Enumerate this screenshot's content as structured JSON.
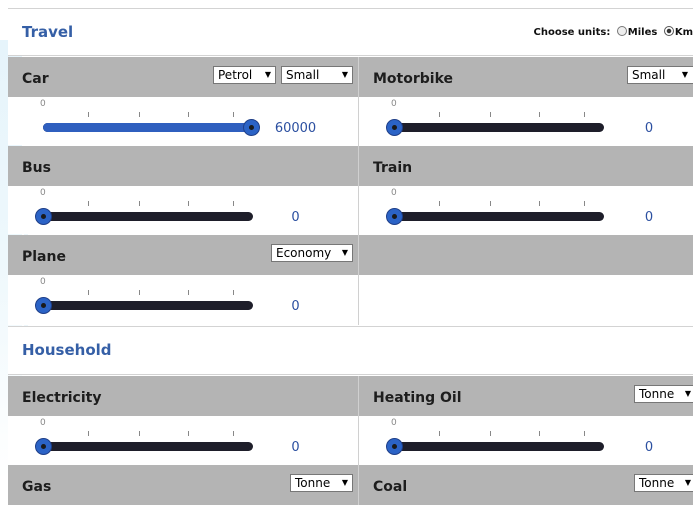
{
  "travel": {
    "title": "Travel",
    "units_label": "Choose units:",
    "units_miles": "Miles",
    "units_km": "Km",
    "car": {
      "label": "Car",
      "fuel": "Petrol",
      "size": "Small",
      "value": "60000",
      "level": 1.0
    },
    "motorbike": {
      "label": "Motorbike",
      "size": "Small",
      "value": "0",
      "level": 0
    },
    "bus": {
      "label": "Bus",
      "value": "0",
      "level": 0
    },
    "train": {
      "label": "Train",
      "value": "0",
      "level": 0
    },
    "plane": {
      "label": "Plane",
      "class": "Economy",
      "value": "0",
      "level": 0
    }
  },
  "household": {
    "title": "Household",
    "electricity": {
      "label": "Electricity",
      "value": "0",
      "level": 0
    },
    "heating_oil": {
      "label": "Heating Oil",
      "unit": "Tonne",
      "value": "0",
      "level": 0
    },
    "gas": {
      "label": "Gas",
      "unit": "Tonne"
    },
    "coal": {
      "label": "Coal",
      "unit": "Tonne"
    }
  },
  "slider_min_label": "0",
  "colors": {
    "accent": "#355fa6",
    "label_bar": "#b4b4b4",
    "track": "#1e1e2a",
    "fill": "#2f5fbf"
  }
}
